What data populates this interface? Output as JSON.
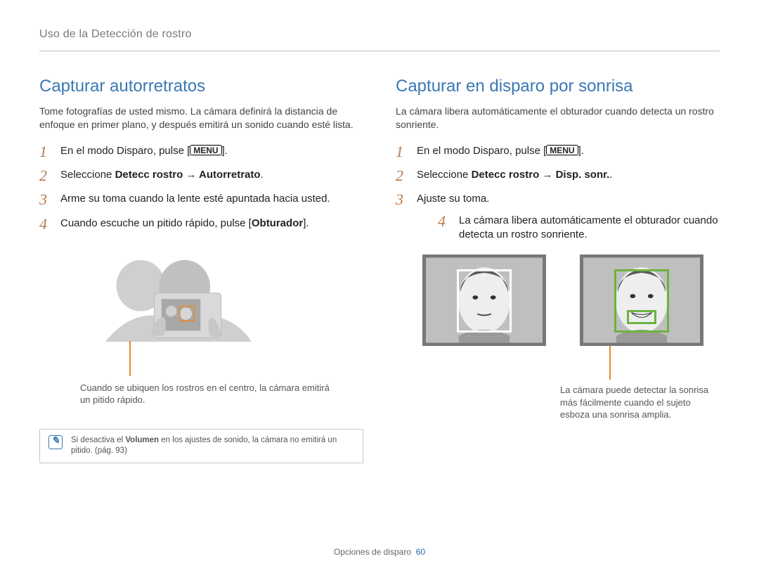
{
  "breadcrumb": "Uso de la Detección de rostro",
  "left": {
    "title": "Capturar autorretratos",
    "intro": "Tome fotografías de usted mismo. La cámara definirá la distancia de enfoque en primer plano, y después emitirá un sonido cuando esté lista.",
    "steps": {
      "s1_pre": "En el modo Disparo, pulse [",
      "s1_menu": "MENU",
      "s1_post": "].",
      "s2_pre": "Seleccione ",
      "s2_bold": "Detecc rostro → Autorretrato",
      "s2_post": ".",
      "s3": "Arme su toma cuando la lente esté apuntada hacia usted.",
      "s4_pre": "Cuando escuche un pitido rápido, pulse [",
      "s4_bold": "Obturador",
      "s4_post": "]."
    },
    "callout": "Cuando se ubiquen los rostros en el centro, la cámara emitirá un pitido rápido.",
    "note_pre": "Si desactiva el ",
    "note_bold": "Volumen",
    "note_post": " en los ajustes de sonido, la cámara no emitirá un pitido. (pág. 93)"
  },
  "right": {
    "title": "Capturar en disparo por sonrisa",
    "intro": "La cámara libera automáticamente el obturador cuando detecta un rostro sonriente.",
    "steps": {
      "s1_pre": "En el modo Disparo, pulse [",
      "s1_menu": "MENU",
      "s1_post": "].",
      "s2_pre": "Seleccione ",
      "s2_bold": "Detecc rostro → Disp. sonr.",
      "s2_post": ".",
      "s3": "Ajuste su toma.",
      "s3_bullet": "La cámara libera automáticamente el obturador cuando detecta un rostro sonriente."
    },
    "callout": "La cámara puede detectar la sonrisa más fácilmente cuando el sujeto esboza una sonrisa amplia."
  },
  "footer": {
    "label": "Opciones de disparo",
    "page": "60"
  }
}
